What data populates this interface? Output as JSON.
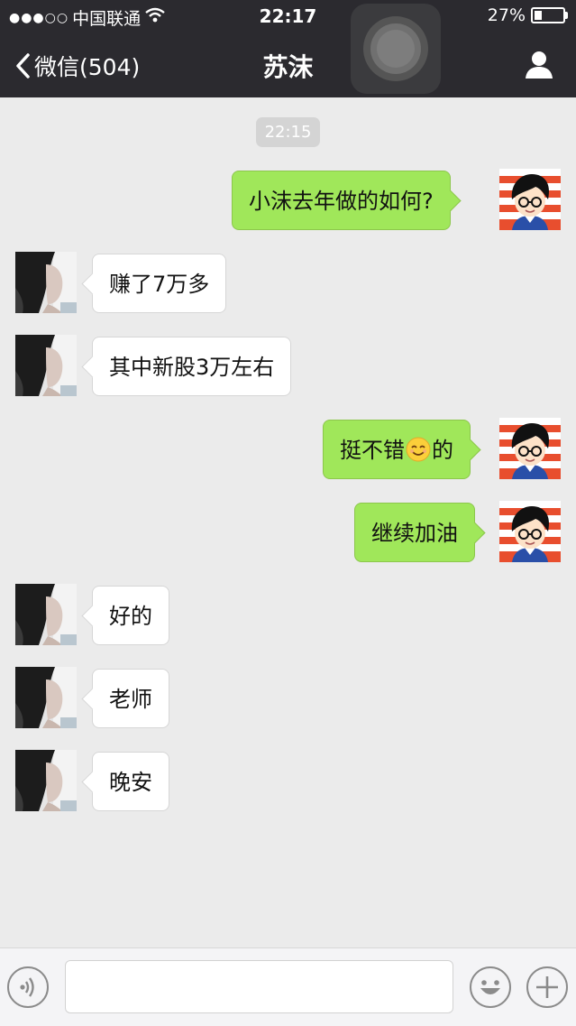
{
  "status_bar": {
    "carrier": "中国联通",
    "time": "22:17",
    "battery": "27%",
    "battery_level": 0.27
  },
  "nav": {
    "back_label": "微信(504)",
    "title": "苏沫"
  },
  "chat": {
    "timestamp": "22:15",
    "messages": [
      {
        "side": "out",
        "text": "小沫去年做的如何?"
      },
      {
        "side": "in",
        "text": "赚了7万多"
      },
      {
        "side": "in",
        "text": "其中新股3万左右"
      },
      {
        "side": "out",
        "text_before": "挺不错",
        "emoji": "smiling-face-emoji",
        "text_after": "的"
      },
      {
        "side": "out",
        "text": "继续加油"
      },
      {
        "side": "in",
        "text": "好的"
      },
      {
        "side": "in",
        "text": "老师"
      },
      {
        "side": "in",
        "text": "晚安"
      }
    ]
  },
  "input": {
    "value": "",
    "placeholder": ""
  },
  "icons": {
    "back": "chevron-left-icon",
    "profile": "person-icon",
    "wifi": "wifi-icon",
    "voice": "voice-icon",
    "emoji": "emoji-icon",
    "plus": "plus-icon"
  },
  "colors": {
    "topbar": "#2b2a2f",
    "outgoing_bubble": "#a0e75a",
    "incoming_bubble": "#ffffff",
    "background": "#ebebeb"
  }
}
